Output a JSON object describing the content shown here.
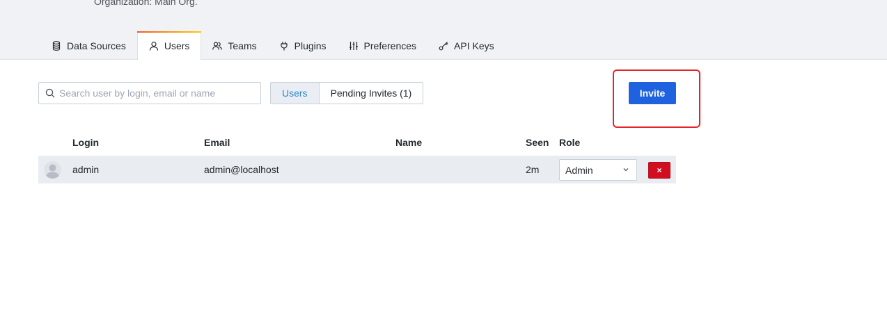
{
  "header": {
    "org_subtitle": "Organization: Main Org.",
    "background": "#f0f2f6"
  },
  "tabs": [
    {
      "label": "Data Sources",
      "icon": "database-icon",
      "active": false
    },
    {
      "label": "Users",
      "icon": "user-icon",
      "active": true
    },
    {
      "label": "Teams",
      "icon": "users-icon",
      "active": false
    },
    {
      "label": "Plugins",
      "icon": "plug-icon",
      "active": false
    },
    {
      "label": "Preferences",
      "icon": "sliders-icon",
      "active": false
    },
    {
      "label": "API Keys",
      "icon": "key-icon",
      "active": false
    }
  ],
  "toolbar": {
    "search_placeholder": "Search user by login, email or name",
    "search_value": "",
    "filter_options": [
      "Users",
      "Pending Invites (1)"
    ],
    "filter_selected": "Users",
    "invite_label": "Invite"
  },
  "table": {
    "columns": [
      "Login",
      "Email",
      "Name",
      "Seen",
      "Role"
    ],
    "rows": [
      {
        "login": "admin",
        "email": "admin@localhost",
        "name": "",
        "seen": "2m",
        "role": "Admin",
        "delete_label": "×"
      }
    ]
  },
  "colors": {
    "primary": "#1f62e0",
    "danger": "#d10e20",
    "annotation": "#e3262a",
    "active_link": "#2b8ac3"
  }
}
